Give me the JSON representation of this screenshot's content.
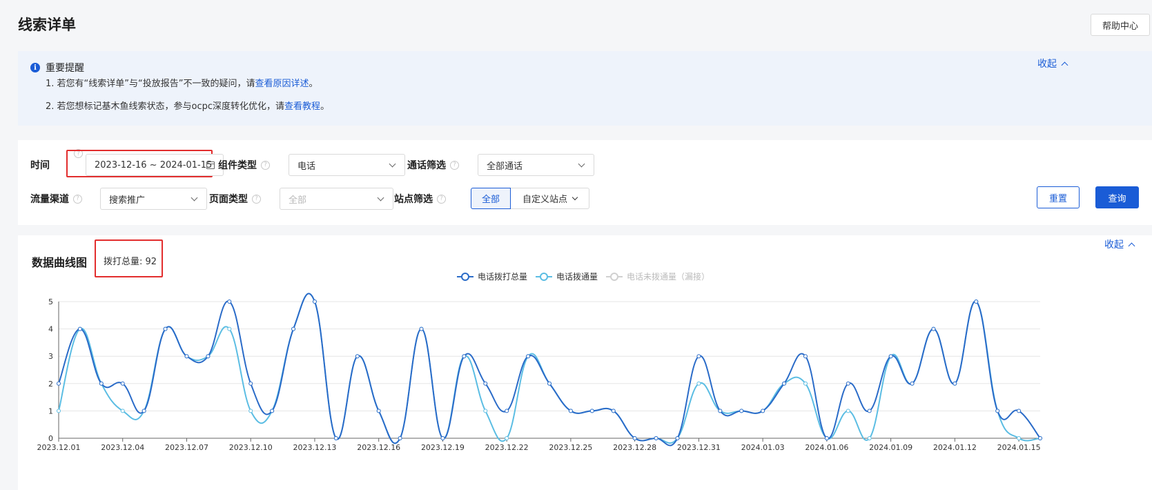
{
  "page": {
    "title": "线索详单",
    "help_label": "帮助中心"
  },
  "notice": {
    "title": "重要提醒",
    "collapse_label": "收起",
    "line1_prefix": "1. 若您有“线索详单”与“投放报告”不一致的疑问，请",
    "line1_link": "查看原因详述",
    "line1_suffix": "。",
    "line2_prefix": "2. 若您想标记基木鱼线索状态，参与ocpc深度转化优化，请",
    "line2_link": "查看教程",
    "line2_suffix": "。"
  },
  "filters": {
    "time_label": "时间",
    "time_value": "2023-12-16 ~ 2024-01-15",
    "component_label": "组件类型",
    "component_value": "电话",
    "call_filter_label": "通话筛选",
    "call_filter_value": "全部通话",
    "channel_label": "流量渠道",
    "channel_value": "搜索推广",
    "page_type_label": "页面类型",
    "page_type_placeholder": "全部",
    "site_label": "站点筛选",
    "site_options": [
      "全部",
      "自定义站点"
    ],
    "site_selected": "全部",
    "reset_label": "重置",
    "query_label": "查询"
  },
  "chart_section": {
    "title": "数据曲线图",
    "total_text": "拨打总量: 92",
    "collapse_label": "收起"
  },
  "colors": {
    "accent": "#1a5cd6",
    "series_total": "#2a6bc8",
    "series_connected": "#5bbde3",
    "series_missed": "#d0d0d0",
    "highlight_border": "#e22d2d"
  },
  "chart_data": {
    "type": "line",
    "categories": [
      "2023.12.01",
      "2023.12.02",
      "2023.12.03",
      "2023.12.04",
      "2023.12.05",
      "2023.12.06",
      "2023.12.07",
      "2023.12.08",
      "2023.12.09",
      "2023.12.10",
      "2023.12.11",
      "2023.12.12",
      "2023.12.13",
      "2023.12.14",
      "2023.12.15",
      "2023.12.16",
      "2023.12.17",
      "2023.12.18",
      "2023.12.19",
      "2023.12.20",
      "2023.12.21",
      "2023.12.22",
      "2023.12.23",
      "2023.12.24",
      "2023.12.25",
      "2023.12.26",
      "2023.12.27",
      "2023.12.28",
      "2023.12.29",
      "2023.12.30",
      "2023.12.31",
      "2024.01.01",
      "2024.01.02",
      "2024.01.03",
      "2024.01.04",
      "2024.01.05",
      "2024.01.06",
      "2024.01.07",
      "2024.01.08",
      "2024.01.09",
      "2024.01.10",
      "2024.01.11",
      "2024.01.12",
      "2024.01.13",
      "2024.01.14",
      "2024.01.15",
      "2024.01.16"
    ],
    "tick_labels": [
      "2023.12.01",
      "2023.12.04",
      "2023.12.07",
      "2023.12.10",
      "2023.12.13",
      "2023.12.16",
      "2023.12.19",
      "2023.12.22",
      "2023.12.25",
      "2023.12.28",
      "2023.12.31",
      "2024.01.03",
      "2024.01.06",
      "2024.01.09",
      "2024.01.12",
      "2024.01.15"
    ],
    "series": [
      {
        "name": "电话拨打总量",
        "values": [
          2,
          4,
          2,
          2,
          1,
          4,
          3,
          3,
          5,
          2,
          1,
          4,
          5,
          0,
          3,
          1,
          0,
          4,
          0,
          3,
          2,
          1,
          3,
          2,
          1,
          1,
          1,
          0,
          0,
          0,
          3,
          1,
          1,
          1,
          2,
          3,
          0,
          2,
          1,
          3,
          2,
          4,
          2,
          5,
          1,
          1,
          0
        ]
      },
      {
        "name": "电话拨通量",
        "values": [
          1,
          4,
          2,
          1,
          1,
          4,
          3,
          3,
          4,
          1,
          1,
          4,
          5,
          0,
          3,
          1,
          0,
          4,
          0,
          3,
          1,
          0,
          3,
          2,
          1,
          1,
          1,
          0,
          0,
          0,
          2,
          1,
          1,
          1,
          2,
          2,
          0,
          1,
          0,
          3,
          2,
          4,
          2,
          5,
          1,
          0,
          0
        ]
      },
      {
        "name": "电话未拨通量（漏接）",
        "values": []
      }
    ],
    "ylim": [
      0,
      5
    ],
    "yticks": [
      0,
      1,
      2,
      3,
      4,
      5
    ],
    "grid": true,
    "legend": "top-center"
  }
}
